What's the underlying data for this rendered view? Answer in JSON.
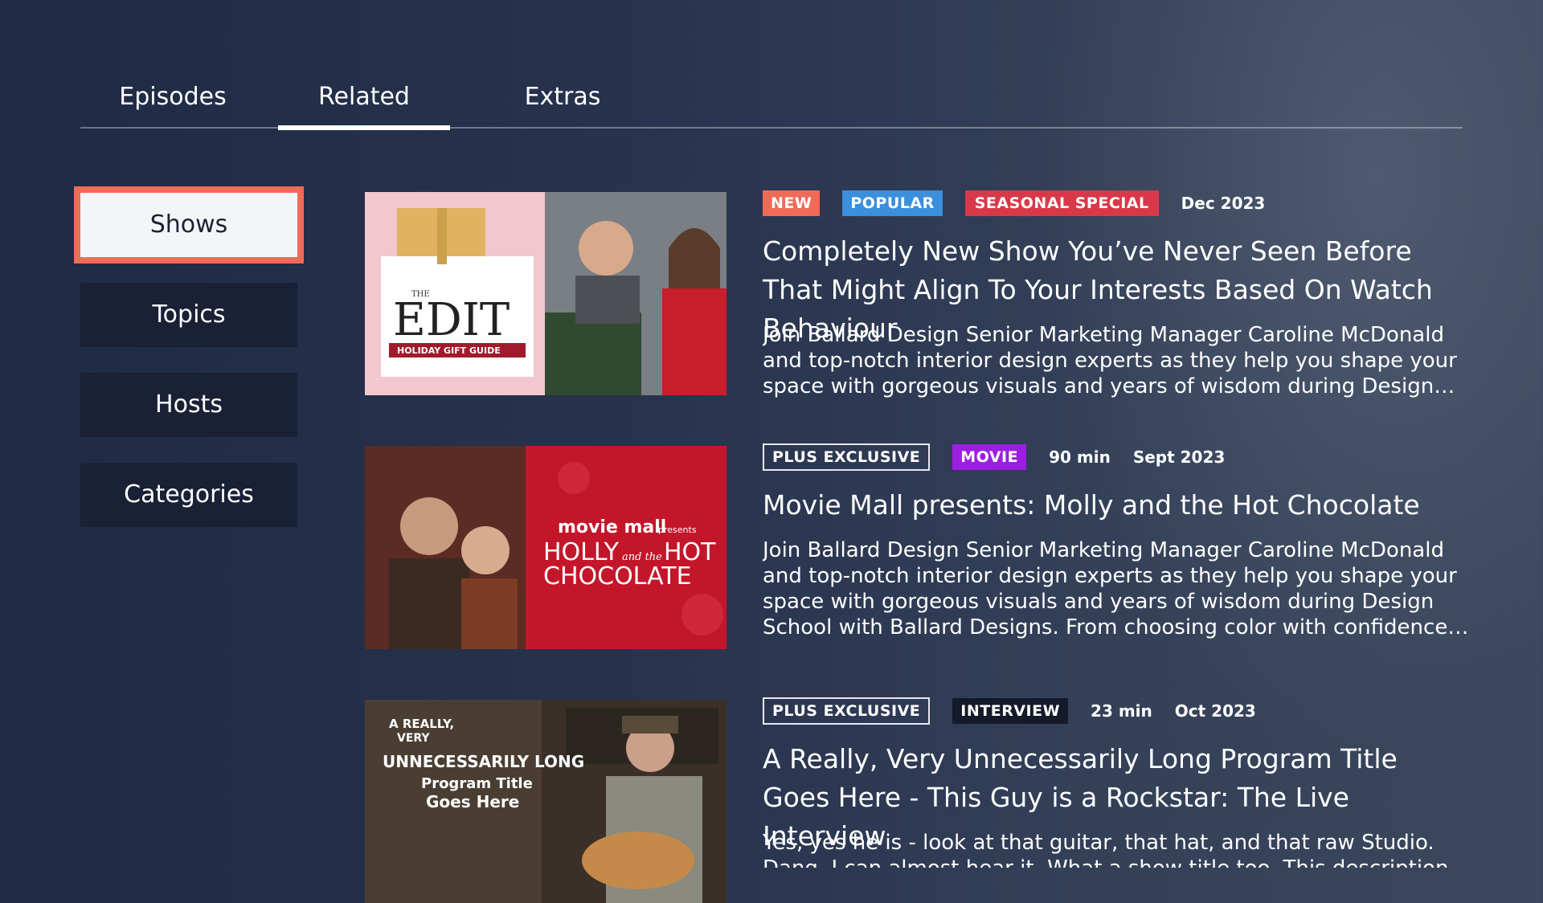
{
  "tabs": [
    {
      "label": "Episodes"
    },
    {
      "label": "Related"
    },
    {
      "label": "Extras"
    }
  ],
  "active_tab": "Related",
  "sidebar": {
    "items": [
      {
        "label": "Shows"
      },
      {
        "label": "Topics"
      },
      {
        "label": "Hosts"
      },
      {
        "label": "Categories"
      }
    ],
    "selected": "Shows"
  },
  "items": [
    {
      "badges": [
        "NEW",
        "POPULAR",
        "SEASONAL SPECIAL"
      ],
      "date": "Dec 2023",
      "title": "Completely New Show You’ve Never Seen Before That Might Align To Your Interests Based On Watch Behaviour",
      "description": "Join Ballard Design Senior Marketing Manager Caroline McDonald and top-notch interior design experts as they help you shape your space with gorgeous visuals and years of wisdom during Design School with Ballard Designs.",
      "thumb": {
        "small": "THE",
        "big": "EDIT",
        "ribbon": "HOLIDAY GIFT GUIDE"
      }
    },
    {
      "badges": [
        "PLUS EXCLUSIVE",
        "MOVIE"
      ],
      "duration": "90 min",
      "date": "Sept 2023",
      "title": "Movie Mall presents: Molly and the Hot Chocolate",
      "description": "Join Ballard Design Senior Marketing Manager Caroline McDonald and top-notch interior design experts as they help you shape your space with gorgeous visuals and years of wisdom during Design School with Ballard Designs. From choosing color with confidence to layering textures and finding the right scale.",
      "thumb": {
        "brand": "movie mall",
        "presents": "presents",
        "line1": "HOLLY",
        "amp": "and the",
        "line1b": "HOT",
        "line2": "CHOCOLATE"
      }
    },
    {
      "badges": [
        "PLUS EXCLUSIVE",
        "INTERVIEW"
      ],
      "duration": "23 min",
      "date": "Oct 2023",
      "title": "A Really, Very Unnecessarily Long Program Title Goes Here - This Guy is a Rockstar: The Live Interview",
      "description": "Yes, yes he is - look at that guitar, that hat, and that raw Studio. Dang, I can almost hear it. What a show title too. This description blew my mind.",
      "thumb": {
        "t1": "A REALLY,",
        "t2": "VERY",
        "t3": "UNNECESSARILY LONG",
        "t4": "Program Title",
        "t5": "Goes Here"
      }
    }
  ],
  "colors": {
    "accent": "#ef6b58",
    "new": "#ef6b58",
    "popular": "#3b8fdc",
    "seasonal": "#d8394a",
    "movie": "#9b1fe0",
    "interview": "#141a2a"
  }
}
